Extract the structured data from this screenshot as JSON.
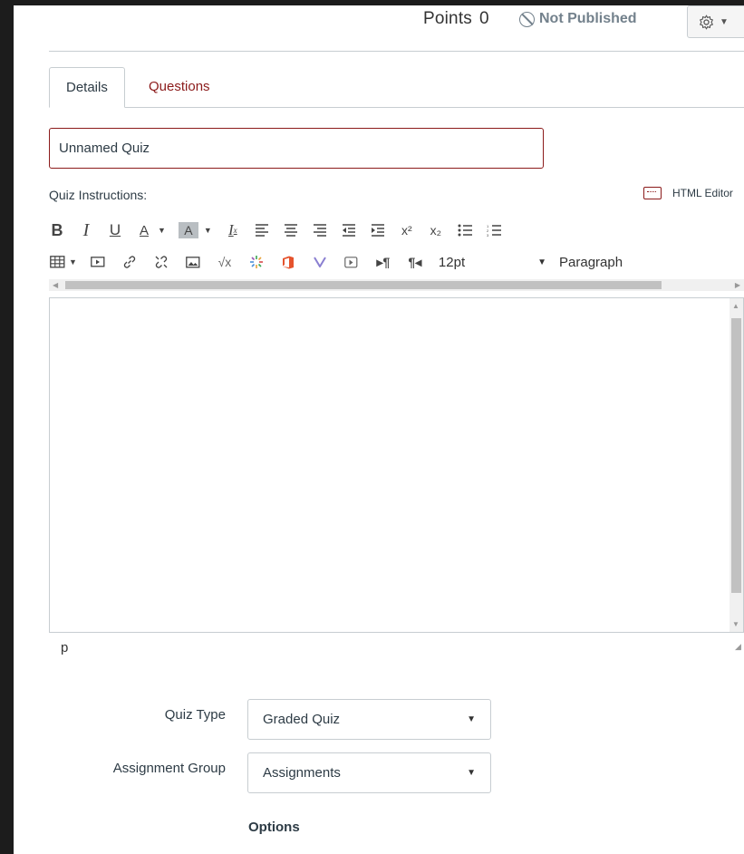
{
  "header": {
    "points_label": "Points",
    "points_value": "0",
    "status": "Not Published",
    "settings_icon": "gear-icon"
  },
  "tabs": [
    {
      "label": "Details",
      "active": true
    },
    {
      "label": "Questions",
      "active": false
    }
  ],
  "title_input": {
    "value": "Unnamed Quiz"
  },
  "instructions": {
    "label": "Quiz Instructions:",
    "html_editor_label": "HTML Editor",
    "font_size": "12pt",
    "block_format": "Paragraph",
    "path": "p"
  },
  "toolbar_row1": [
    "B",
    "I",
    "U",
    "A",
    "A",
    "Ix",
    "align-left",
    "align-center",
    "align-right",
    "outdent",
    "indent",
    "x²",
    "x₂",
    "bullet-list",
    "numbered-list"
  ],
  "toolbar_row2": [
    "table",
    "media",
    "link",
    "unlink",
    "image",
    "√x",
    "apps",
    "office",
    "v",
    "video",
    "ltr",
    "rtl"
  ],
  "form": {
    "quiz_type_label": "Quiz Type",
    "quiz_type_value": "Graded Quiz",
    "assignment_group_label": "Assignment Group",
    "assignment_group_value": "Assignments",
    "options_label": "Options"
  },
  "colors": {
    "accent": "#8b1a1a",
    "border": "#c7cdd1",
    "text": "#2d3b45",
    "muted": "#73818c"
  }
}
